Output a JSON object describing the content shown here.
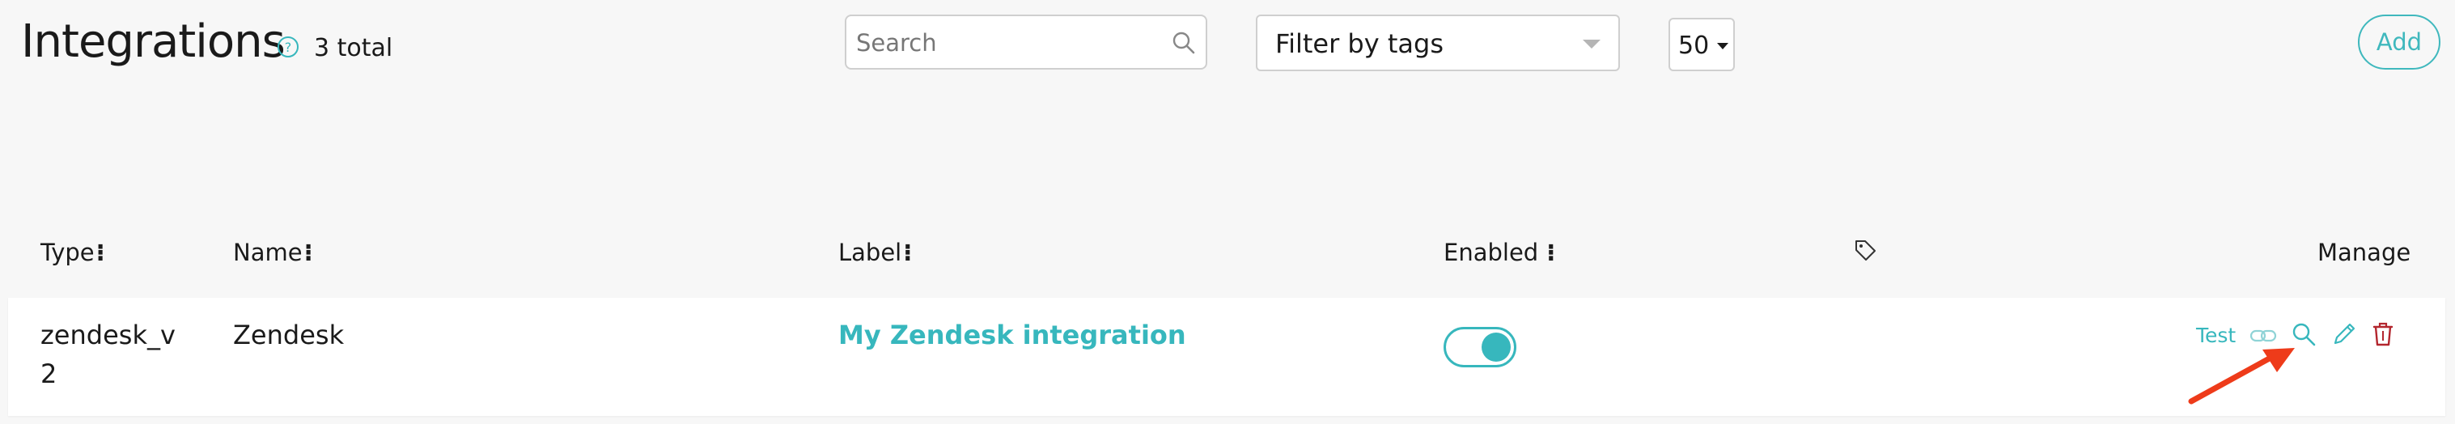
{
  "header": {
    "title": "Integrations",
    "total_label": "3 total",
    "search": {
      "placeholder": "Search",
      "value": ""
    },
    "tag_filter": {
      "label": "Filter by tags"
    },
    "page_size": {
      "value": "50"
    },
    "add_label": "Add"
  },
  "table": {
    "columns": {
      "type": "Type",
      "name": "Name",
      "label": "Label",
      "enabled": "Enabled",
      "tags_icon": "tag-icon",
      "manage": "Manage"
    },
    "sort_marker": "⁝",
    "rows": [
      {
        "type": "zendesk_v2",
        "name": "Zendesk",
        "label": "My Zendesk integration",
        "enabled": true,
        "actions": {
          "test_label": "Test",
          "icons": [
            "link-icon",
            "inspect-icon",
            "edit-icon",
            "delete-icon"
          ]
        }
      }
    ]
  },
  "colors": {
    "accent": "#37b7bd",
    "delete": "#b3262e",
    "annotation_arrow": "#ee3b1a",
    "background": "#f7f7f7"
  }
}
